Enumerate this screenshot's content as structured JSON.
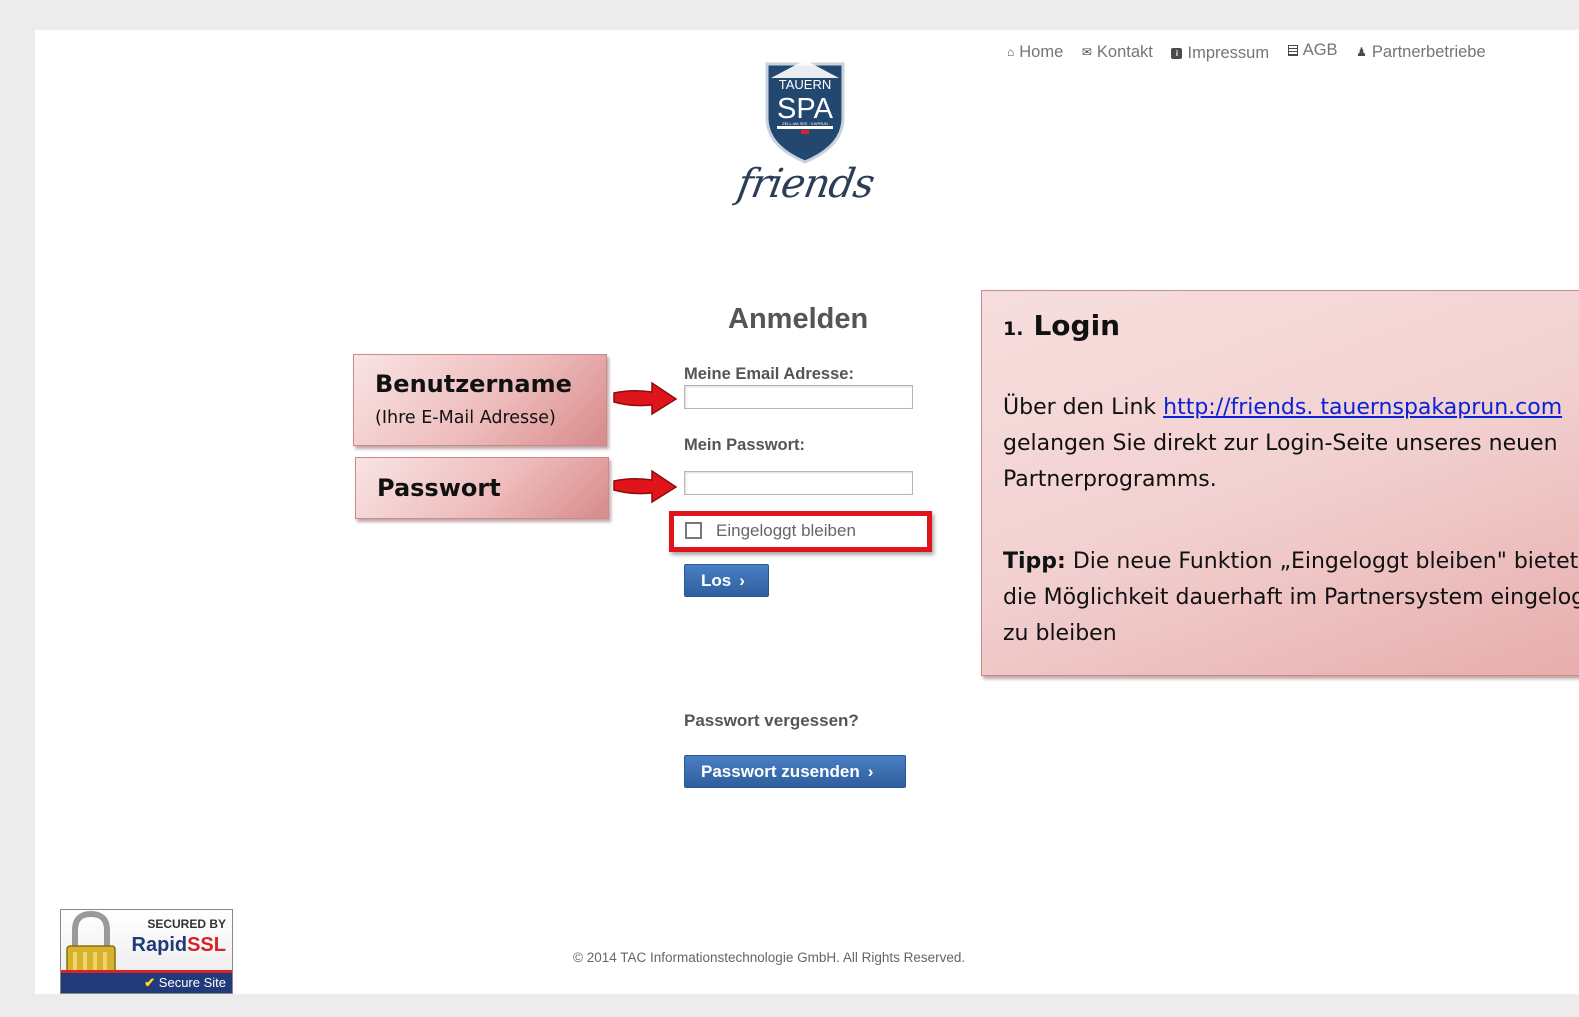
{
  "nav": {
    "items": [
      {
        "icon": "home-icon",
        "label": "Home"
      },
      {
        "icon": "envelope-icon",
        "label": "Kontakt"
      },
      {
        "icon": "info-icon",
        "label": "Impressum"
      },
      {
        "icon": "document-icon",
        "label": "AGB"
      },
      {
        "icon": "user-icon",
        "label": "Partnerbetriebe"
      }
    ]
  },
  "logo": {
    "line1": "TAUERN",
    "line2": "SPA",
    "line3": "ZELL AM SEE · KAPRUN",
    "script": "friends"
  },
  "form": {
    "title": "Anmelden",
    "email_label": "Meine Email Adresse:",
    "email_value": "",
    "password_label": "Mein Passwort:",
    "password_value": "",
    "remember_label": "Eingeloggt bleiben",
    "remember_checked": false,
    "submit_label": "Los",
    "forgot_label": "Passwort vergessen?",
    "send_password_label": "Passwort zusenden"
  },
  "annotations": {
    "username_title": "Benutzername",
    "username_sub": "(Ihre E-Mail Adresse)",
    "password_title": "Passwort",
    "info": {
      "number": "1.",
      "title": "Login",
      "line1_prefix": "Über den Link ",
      "link_text": "http://friends. tauernspakaprun.com",
      "line2": "gelangen Sie direkt zur Login-Seite unseres neuen",
      "line3": "Partnerprogramms.",
      "tip_label": "Tipp:",
      "tip_line1": " Die neue Funktion „Eingeloggt bleiben\" bietet",
      "tip_line2": "die Möglichkeit dauerhaft im Partnersystem eingeloggt",
      "tip_line3": "zu bleiben"
    },
    "highlight_color": "#e0151b",
    "callout_color": "#eebcbc"
  },
  "ssl_badge": {
    "secured_by": "SECURED BY",
    "brand_part1": "Rapid",
    "brand_part2": "SSL",
    "secure_site": "Secure Site"
  },
  "footer": {
    "copyright": "© 2014 TAC Informationstechnologie GmbH. All Rights Reserved."
  },
  "colors": {
    "button": "#3b6fb0",
    "text_gray": "#555555",
    "link": "#0a22d6"
  }
}
